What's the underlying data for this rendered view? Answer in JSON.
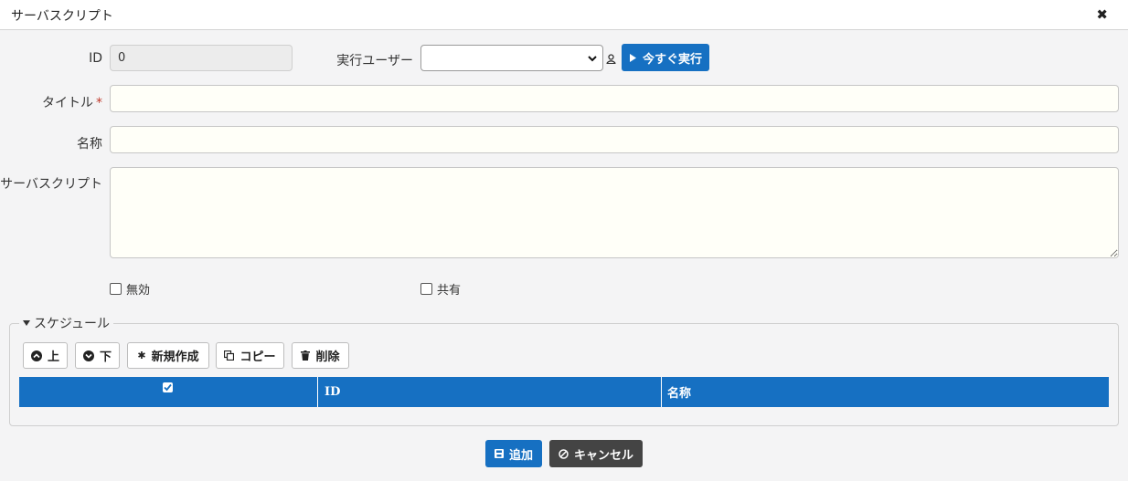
{
  "window": {
    "title": "サーバスクリプト",
    "close_icon": "close-icon"
  },
  "form": {
    "id_label": "ID",
    "id_value": "0",
    "exec_user_label": "実行ユーザー",
    "exec_user_value": "",
    "run_now_label": "今すぐ実行",
    "title_label": "タイトル",
    "required_mark": "*",
    "title_value": "",
    "name_label": "名称",
    "name_value": "",
    "script_label": "サーバスクリプト",
    "script_value": "",
    "disabled_label": "無効",
    "disabled_checked": false,
    "shared_label": "共有",
    "shared_checked": false
  },
  "schedule": {
    "legend": "スケジュール",
    "toolbar": {
      "up": "上",
      "down": "下",
      "new": "新規作成",
      "copy": "コピー",
      "delete": "削除"
    },
    "columns": [
      "",
      "ID",
      "名称"
    ],
    "rows": []
  },
  "footer": {
    "add_label": "追加",
    "cancel_label": "キャンセル"
  },
  "colors": {
    "primary": "#1670c2",
    "dark": "#444444",
    "required": "#c0392b"
  }
}
